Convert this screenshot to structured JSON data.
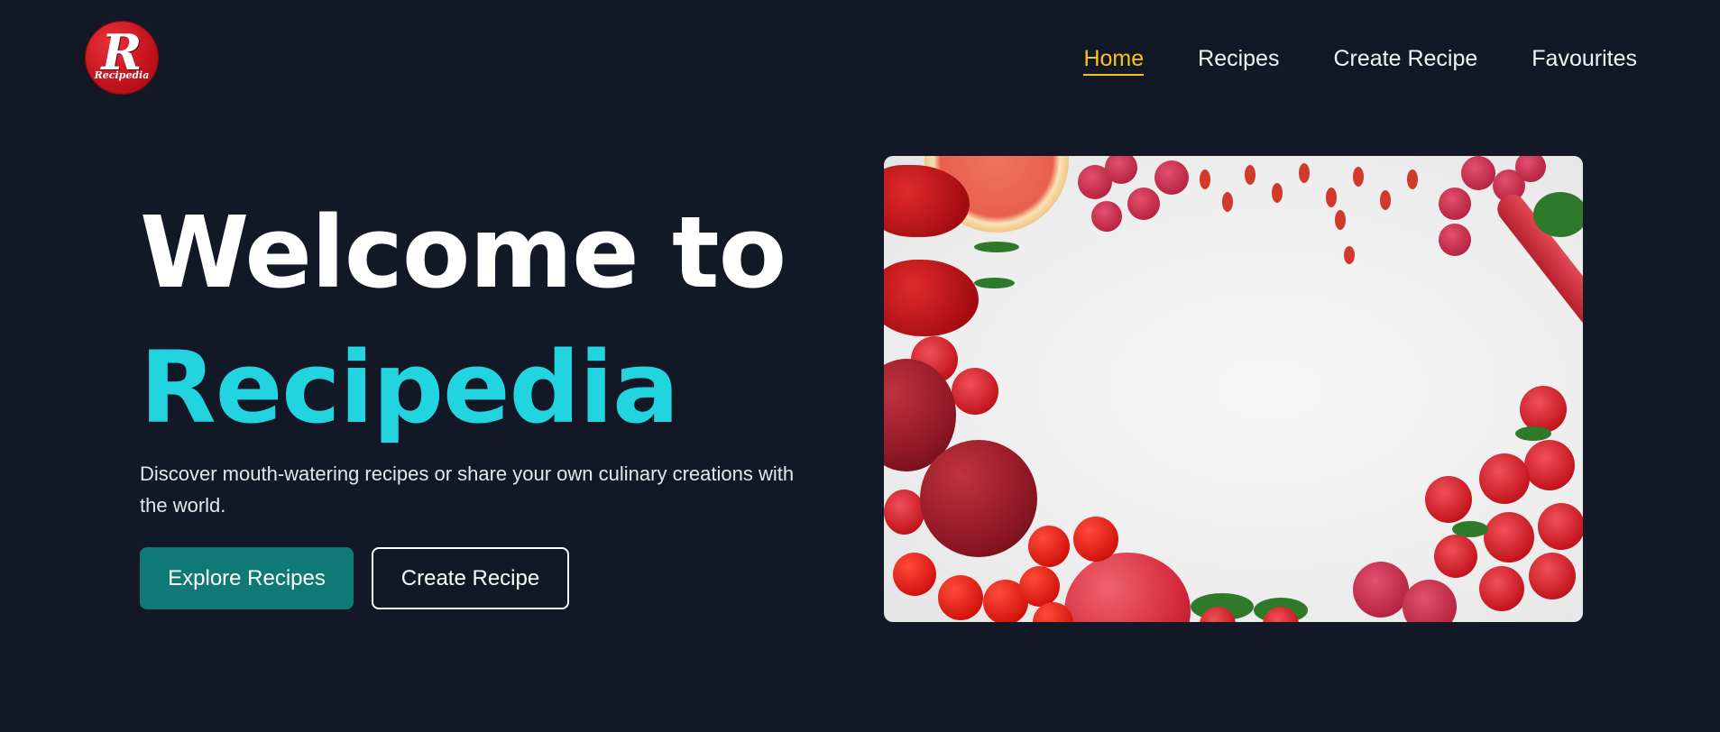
{
  "brand": {
    "logo_letter": "R",
    "logo_text": "Recipedia",
    "colors": {
      "background": "#121826",
      "accent": "#22d3e0",
      "nav_active": "#f5c518",
      "primary_button": "#0f7a75",
      "logo": "#c5141d"
    }
  },
  "nav": {
    "items": [
      {
        "label": "Home",
        "active": true
      },
      {
        "label": "Recipes",
        "active": false
      },
      {
        "label": "Create Recipe",
        "active": false
      },
      {
        "label": "Favourites",
        "active": false
      }
    ]
  },
  "hero": {
    "title_line1": "Welcome to",
    "title_line2": "Recipedia",
    "description": "Discover mouth-watering recipes or share your own culinary creations with the world.",
    "primary_button": "Explore Recipes",
    "secondary_button": "Create Recipe"
  }
}
